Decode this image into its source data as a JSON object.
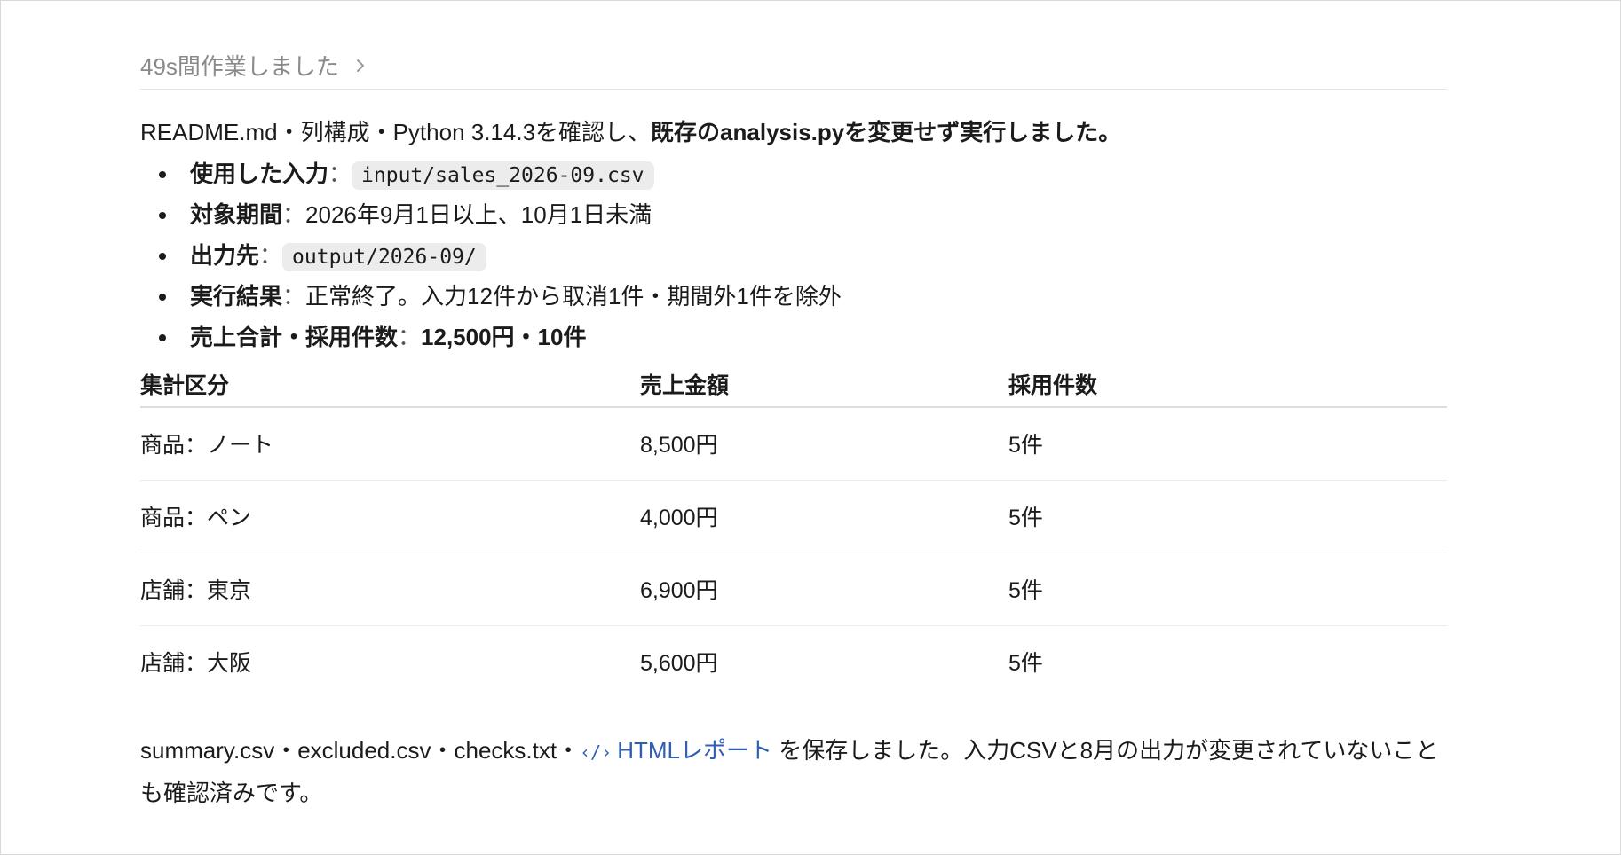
{
  "header": {
    "worked_label": "49s間作業しました"
  },
  "intro": {
    "prefix": "README.md・列構成・Python 3.14.3を確認し、",
    "bold": "既存のanalysis.pyを変更せず実行しました。"
  },
  "bullets": {
    "input_label": "使用した入力",
    "input_value": "input/sales_2026-09.csv",
    "period_label": "対象期間",
    "period_value": "2026年9月1日以上、10月1日未満",
    "output_label": "出力先",
    "output_value": "output/2026-09/",
    "result_label": "実行結果",
    "result_value": "正常終了。入力12件から取消1件・期間外1件を除外",
    "total_label": "売上合計・採用件数",
    "total_value": "12,500円・10件",
    "separator": "："
  },
  "table": {
    "headers": [
      "集計区分",
      "売上金額",
      "採用件数"
    ],
    "rows": [
      [
        "商品：ノート",
        "8,500円",
        "5件"
      ],
      [
        "商品：ペン",
        "4,000円",
        "5件"
      ],
      [
        "店舗：東京",
        "6,900円",
        "5件"
      ],
      [
        "店舗：大阪",
        "5,600円",
        "5件"
      ]
    ]
  },
  "summary": {
    "files": "summary.csv・excluded.csv・checks.txt・",
    "link_icon": "code-icon",
    "link_label": "HTMLレポート",
    "suffix": " を保存しました。入力CSVと8月の出力が変更されていないことも確認済みです。"
  },
  "colors": {
    "link": "#2f5fb3",
    "muted": "#8a8a8a",
    "code_bg": "#ececec"
  }
}
